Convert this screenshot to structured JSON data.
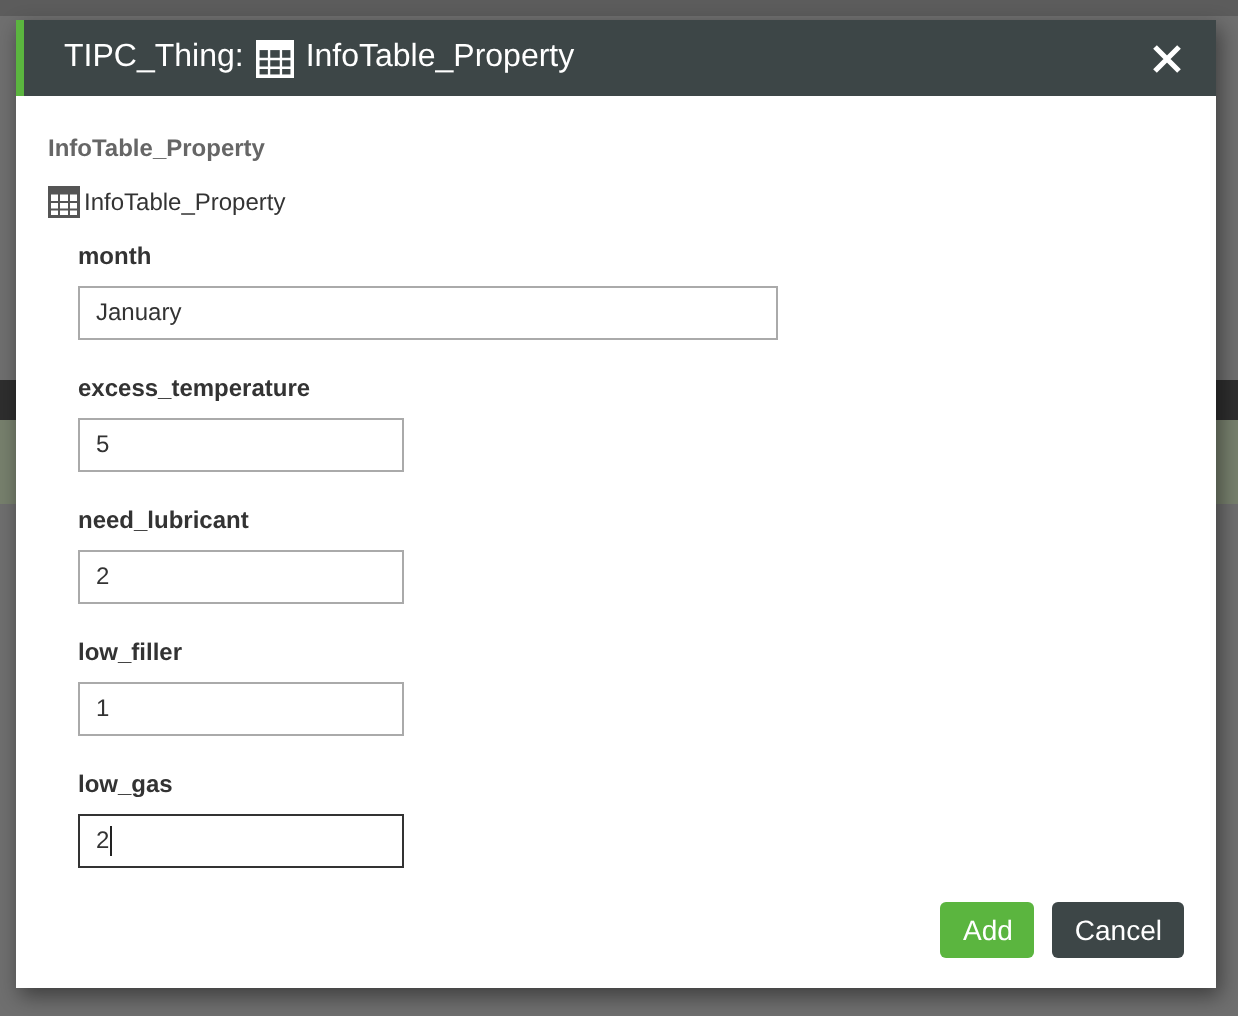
{
  "dialog": {
    "title_prefix": "TIPC_Thing:",
    "title": "InfoTable_Property"
  },
  "section_title": "InfoTable_Property",
  "tree_item": {
    "label": "InfoTable_Property"
  },
  "fields": [
    {
      "label": "month",
      "value": "January",
      "kind": "text",
      "focused": false
    },
    {
      "label": "excess_temperature",
      "value": "5",
      "kind": "number",
      "focused": false
    },
    {
      "label": "need_lubricant",
      "value": "2",
      "kind": "number",
      "focused": false
    },
    {
      "label": "low_filler",
      "value": "1",
      "kind": "number",
      "focused": false
    },
    {
      "label": "low_gas",
      "value": "2",
      "kind": "number",
      "focused": true
    }
  ],
  "buttons": [
    {
      "label": "Add",
      "kind": "primary"
    },
    {
      "label": "Cancel",
      "kind": "secondary"
    }
  ]
}
